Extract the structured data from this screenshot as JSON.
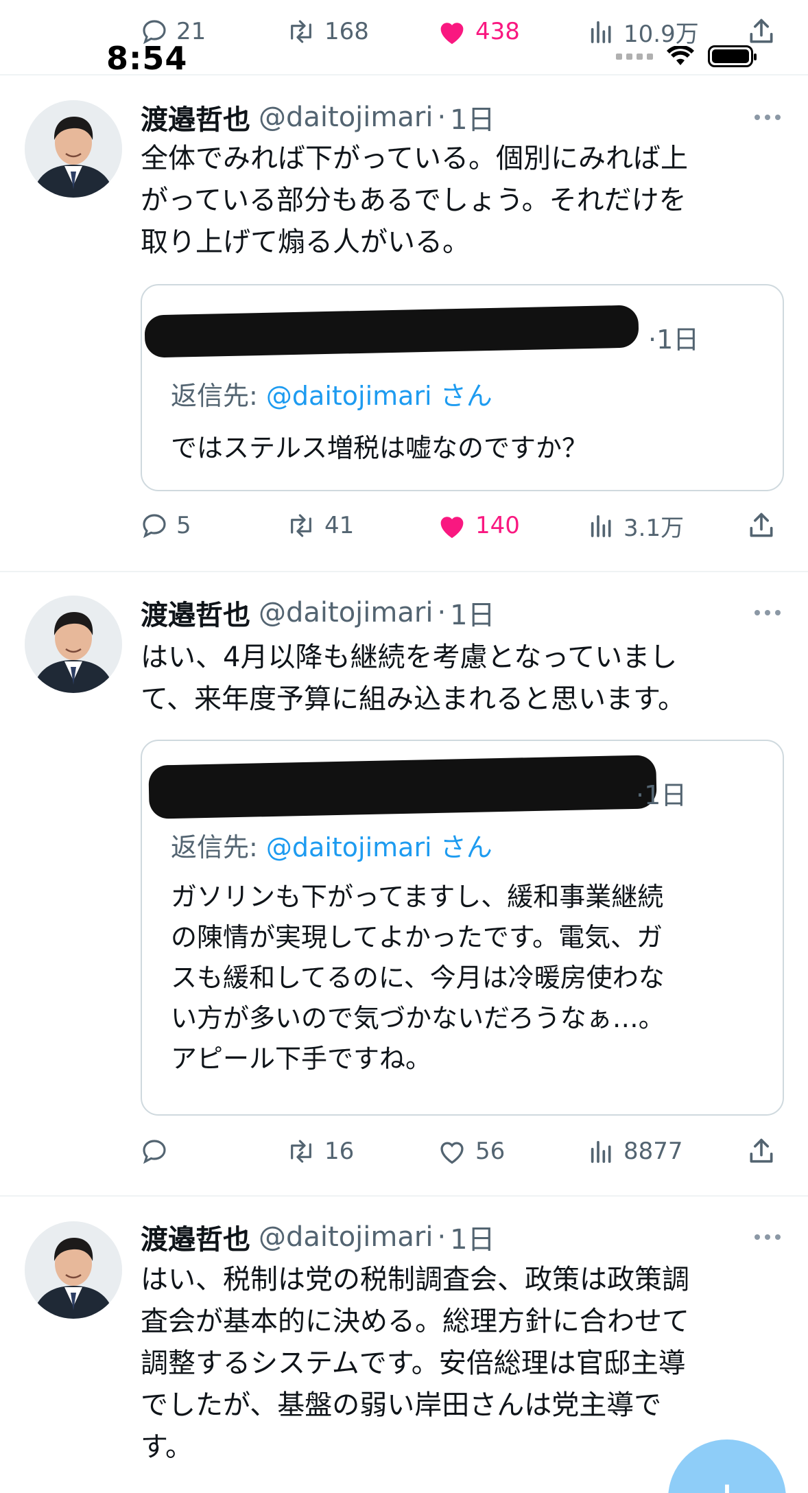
{
  "status_bar": {
    "time": "8:54"
  },
  "top_actions": {
    "replies": "21",
    "retweets": "168",
    "likes": "438",
    "views": "10.9万"
  },
  "tweets": [
    {
      "author": "渡邉哲也",
      "handle": "@daitojimari",
      "time": "1日",
      "text": "全体でみれば下がっている。個別にみれば上\nがっている部分もあるでしょう。それだけを\n取り上げて煽る人がいる。",
      "quote": {
        "time": "1日",
        "reply_to_label": "返信先:",
        "reply_to_handle": "@daitojimari",
        "reply_to_suffix": "さん",
        "text": "ではステルス増税は嘘なのですか？"
      },
      "actions": {
        "replies": "5",
        "retweets": "41",
        "likes": "140",
        "views": "3.1万"
      }
    },
    {
      "author": "渡邉哲也",
      "handle": "@daitojimari",
      "time": "1日",
      "text": "はい、4月以降も継続を考慮となっていまし\nて、来年度予算に組み込まれると思います。",
      "quote": {
        "time": "1日",
        "reply_to_label": "返信先:",
        "reply_to_handle": "@daitojimari",
        "reply_to_suffix": "さん",
        "text": "ガソリンも下がってますし、緩和事業継続\nの陳情が実現してよかったです。電気、ガ\nスも緩和してるのに、今月は冷暖房使わな\nい方が多いので気づかないだろうなぁ…。\nアピール下手ですね。"
      },
      "actions": {
        "replies": "",
        "retweets": "16",
        "likes": "56",
        "views": "8877"
      }
    },
    {
      "author": "渡邉哲也",
      "handle": "@daitojimari",
      "time": "1日",
      "text": "はい、税制は党の税制調査会、政策は政策調\n査会が基本的に決める。総理方針に合わせて\n調整するシステムです。安倍総理は官邸主導\nでしたが、基盤の弱い岸田さんは党主導で\nす。"
    }
  ],
  "fab": {
    "label": "+"
  },
  "colors": {
    "like": "#f91880",
    "link": "#1d9bf0",
    "muted": "#536471",
    "border": "#cfd9de",
    "fab": "#8ecdf8"
  }
}
